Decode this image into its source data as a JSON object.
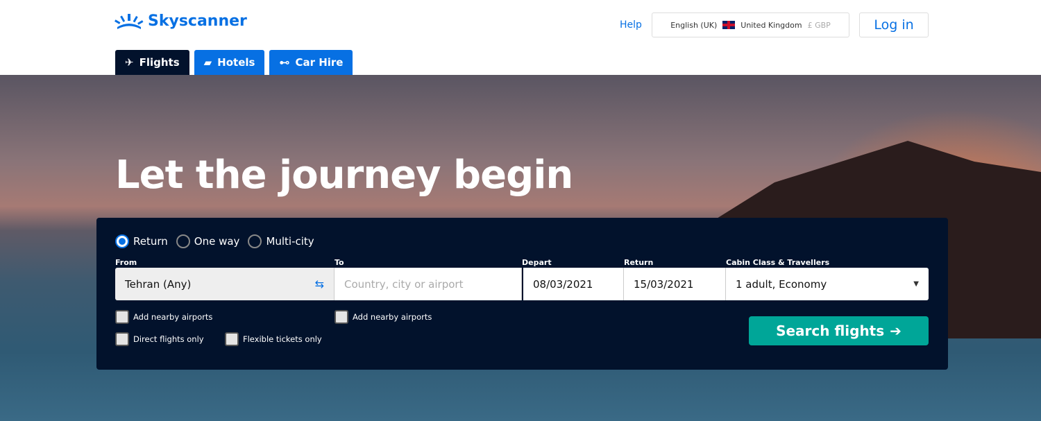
{
  "header": {
    "brand": "Skyscanner",
    "help": "Help",
    "language": "English (UK)",
    "country": "United Kingdom",
    "currency": "£ GBP",
    "login": "Log in"
  },
  "tabs": [
    {
      "label": "Flights",
      "icon": "plane-icon"
    },
    {
      "label": "Hotels",
      "icon": "bed-icon"
    },
    {
      "label": "Car Hire",
      "icon": "car-icon"
    }
  ],
  "hero": {
    "headline": "Let the journey begin"
  },
  "search": {
    "trip_types": [
      "Return",
      "One way",
      "Multi-city"
    ],
    "selected_trip": "Return",
    "from_label": "From",
    "from_value": "Tehran (Any)",
    "to_label": "To",
    "to_placeholder": "Country, city or airport",
    "depart_label": "Depart",
    "depart_value": "08/03/2021",
    "return_label": "Return",
    "return_value": "15/03/2021",
    "cabin_label": "Cabin Class & Travellers",
    "cabin_value": "1 adult, Economy",
    "nearby_from": "Add nearby airports",
    "nearby_to": "Add nearby airports",
    "direct": "Direct flights only",
    "flexible": "Flexible tickets only",
    "submit": "Search flights"
  },
  "colors": {
    "brand": "#0770e3",
    "panel": "#02122c",
    "search_button": "#00a698"
  }
}
